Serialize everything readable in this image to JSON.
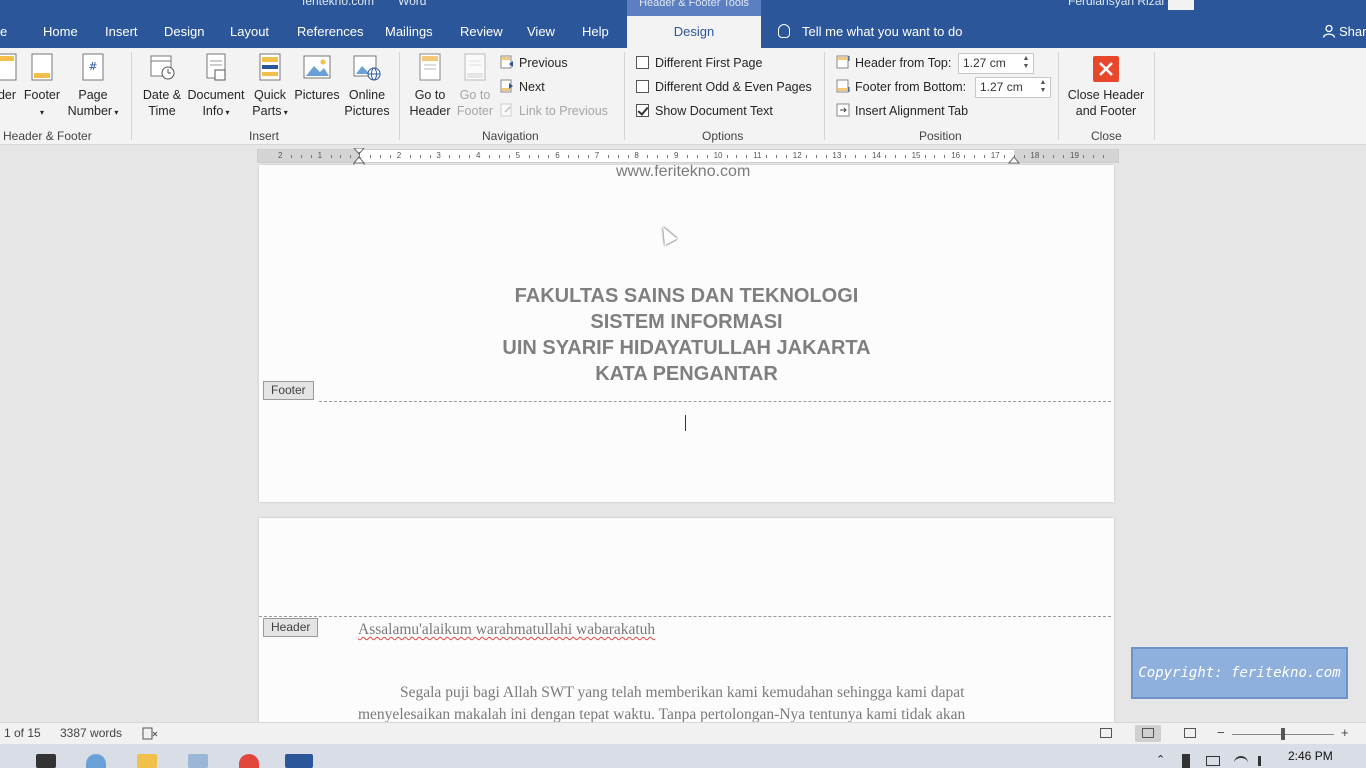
{
  "titlebar": {
    "doc_name": "feritekno.com",
    "app_name": "Word",
    "context_tab_label": "Header & Footer Tools",
    "user_name": "Ferdiansyah Rizal F"
  },
  "tabs": [
    {
      "label": "e"
    },
    {
      "label": "Home"
    },
    {
      "label": "Insert"
    },
    {
      "label": "Design"
    },
    {
      "label": "Layout"
    },
    {
      "label": "References"
    },
    {
      "label": "Mailings"
    },
    {
      "label": "Review"
    },
    {
      "label": "View"
    },
    {
      "label": "Help"
    },
    {
      "label": "Design"
    }
  ],
  "tell_me": "Tell me what you want to do",
  "share": "Shar",
  "ribbon": {
    "header_footer": {
      "header_label": "der",
      "footer_label": "Footer",
      "page_number_l1": "Page",
      "page_number_l2": "Number",
      "group_label": "Header & Footer"
    },
    "insert": {
      "date_time_l1": "Date &",
      "date_time_l2": "Time",
      "doc_info_l1": "Document",
      "doc_info_l2": "Info",
      "quick_parts_l1": "Quick",
      "quick_parts_l2": "Parts",
      "pictures": "Pictures",
      "online_pictures_l1": "Online",
      "online_pictures_l2": "Pictures",
      "group_label": "Insert"
    },
    "navigation": {
      "goto_header_l1": "Go to",
      "goto_header_l2": "Header",
      "goto_footer_l1": "Go to",
      "goto_footer_l2": "Footer",
      "previous": "Previous",
      "next": "Next",
      "link_previous": "Link to Previous",
      "group_label": "Navigation"
    },
    "options": {
      "different_first_page": "Different First Page",
      "different_odd_even": "Different Odd & Even Pages",
      "show_document_text": "Show Document Text",
      "group_label": "Options"
    },
    "position": {
      "header_from_top_label": "Header from Top:",
      "header_from_top_value": "1.27 cm",
      "footer_from_bottom_label": "Footer from Bottom:",
      "footer_from_bottom_value": "1.27 cm",
      "insert_alignment_tab": "Insert Alignment Tab",
      "group_label": "Position"
    },
    "close": {
      "close_l1": "Close Header",
      "close_l2": "and Footer",
      "group_label": "Close"
    }
  },
  "ruler_numbers": [
    "2",
    "1",
    "1",
    "2",
    "3",
    "4",
    "5",
    "6",
    "7",
    "8",
    "9",
    "10",
    "11",
    "12",
    "13",
    "14",
    "15",
    "16",
    "17",
    "18",
    "19"
  ],
  "document": {
    "page1": {
      "url_text": "www.feritekno.com",
      "titles": [
        "FAKULTAS SAINS DAN TEKNOLOGI",
        "SISTEM INFORMASI",
        "UIN SYARIF HIDAYATULLAH JAKARTA",
        "KATA PENGANTAR"
      ],
      "footer_tag": "Footer"
    },
    "page2": {
      "header_tag": "Header",
      "greeting": "Assalamu'alaikum warahmatullahi wabarakatuh",
      "para_line1": "Segala puji bagi Allah SWT yang telah memberikan kami kemudahan sehingga kami dapat",
      "para_line2": "menyelesaikan makalah ini dengan tepat waktu. Tanpa pertolongan-Nya tentunya kami tidak akan"
    }
  },
  "watermark": "Copyright: feritekno.com",
  "statusbar": {
    "page": "1 of 15",
    "words": "3387 words",
    "zoom_minus": "−",
    "zoom_plus": "+"
  },
  "taskbar": {
    "clock": "2:46 PM"
  },
  "colors": {
    "accent": "#2b579a",
    "ribbon_bg": "#f3f3f3",
    "close_red": "#e8472b"
  }
}
